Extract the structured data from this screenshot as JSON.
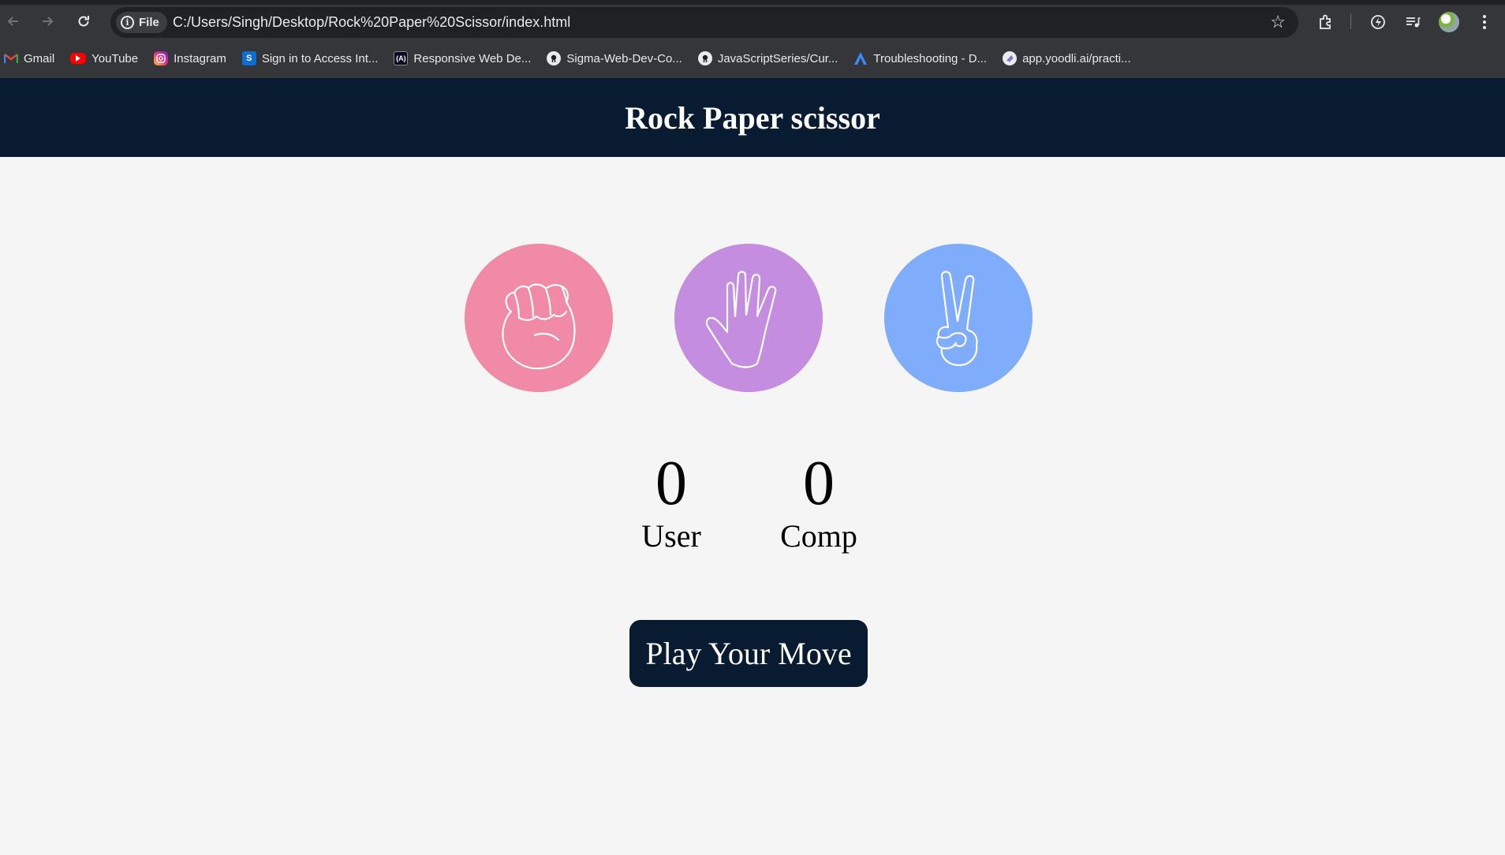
{
  "browser": {
    "file_label": "File",
    "url": "C:/Users/Singh/Desktop/Rock%20Paper%20Scissor/index.html",
    "bookmarks": [
      {
        "label": "Gmail",
        "icon": "gmail-icon"
      },
      {
        "label": "YouTube",
        "icon": "youtube-icon"
      },
      {
        "label": "Instagram",
        "icon": "instagram-icon"
      },
      {
        "label": "Sign in to Access Int...",
        "icon": "s-icon"
      },
      {
        "label": "Responsive Web De...",
        "icon": "a-icon"
      },
      {
        "label": "Sigma-Web-Dev-Co...",
        "icon": "github-icon"
      },
      {
        "label": "JavaScriptSeries/Cur...",
        "icon": "github-icon"
      },
      {
        "label": "Troubleshooting - D...",
        "icon": "triangle-icon"
      },
      {
        "label": "app.yoodli.ai/practi...",
        "icon": "yoodli-icon"
      }
    ]
  },
  "page": {
    "title": "Rock Paper scissor",
    "choices": [
      {
        "name": "rock",
        "color": "#f08aa6"
      },
      {
        "name": "paper",
        "color": "#c48ddf"
      },
      {
        "name": "scissor",
        "color": "#80acfc"
      }
    ],
    "scores": {
      "user_score": "0",
      "user_label": "User",
      "comp_score": "0",
      "comp_label": "Comp"
    },
    "message": "Play Your Move"
  },
  "colors": {
    "header_bg": "#081b31",
    "page_bg": "#f5f5f5"
  }
}
